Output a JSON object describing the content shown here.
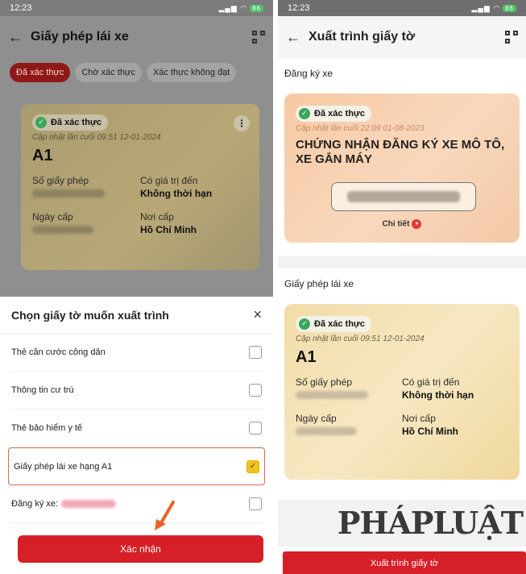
{
  "left": {
    "status_time": "12:23",
    "status_battery": "86",
    "title": "Giấy phép lái xe",
    "back_glyph": "←",
    "tabs": [
      {
        "label": "Đã xác thực"
      },
      {
        "label": "Chờ xác thực"
      },
      {
        "label": "Xác thực không đạt"
      }
    ],
    "card": {
      "badge": "Đã xác thực",
      "updated": "Cập nhật lần cuối 09:51 12-01-2024",
      "class": "A1",
      "license_no_label": "Số giấy phép",
      "valid_label": "Có giá trị đến",
      "valid_value": "Không thời hạn",
      "issue_date_label": "Ngày cấp",
      "issue_place_label": "Nơi cấp",
      "issue_place_value": "Hồ Chí Minh"
    },
    "sheet": {
      "title": "Chọn giấy tờ muốn xuất trình",
      "close": "×",
      "options": [
        {
          "label": "Thẻ căn cước công dân",
          "checked": false
        },
        {
          "label": "Thông tin cư trú",
          "checked": false
        },
        {
          "label": "Thẻ bảo hiểm y tế",
          "checked": false
        },
        {
          "label": "Giấy phép lái xe hạng A1",
          "checked": true
        },
        {
          "label": "Đăng ký xe:",
          "checked": false
        }
      ],
      "confirm": "Xác nhận"
    }
  },
  "right": {
    "status_time": "12:23",
    "status_battery": "86",
    "title": "Xuất trình giấy tờ",
    "back_glyph": "←",
    "reg_section": "Đăng ký xe",
    "reg_card": {
      "badge": "Đã xác thực",
      "updated": "Cập nhật lần cuối 22:09 01-08-2023",
      "title": "CHỨNG NHẬN ĐĂNG KÝ XE MÔ TÔ, XE GẮN MÁY",
      "detail": "Chi tiết"
    },
    "license_section": "Giấy phép lái xe",
    "license_card": {
      "badge": "Đã xác thực",
      "updated": "Cập nhật lần cuối 09:51 12-01-2024",
      "class": "A1",
      "license_no_label": "Số giấy phép",
      "valid_label": "Có giá trị đến",
      "valid_value": "Không thời hạn",
      "issue_date_label": "Ngày cấp",
      "issue_place_label": "Nơi cấp",
      "issue_place_value": "Hồ Chí Minh"
    },
    "watermark": "PHÁPLUẬT",
    "present_button": "Xuất trình giấy tờ"
  },
  "colors": {
    "accent_red": "#d61f26",
    "verified_green": "#3aa65a",
    "checkbox_yellow": "#f1c21b"
  },
  "icons": [
    "back-arrow-icon",
    "qr-code-icon",
    "check-circle-icon",
    "more-icon",
    "close-icon",
    "checkbox-icon",
    "eye-icon",
    "pointer-arrow-icon"
  ]
}
